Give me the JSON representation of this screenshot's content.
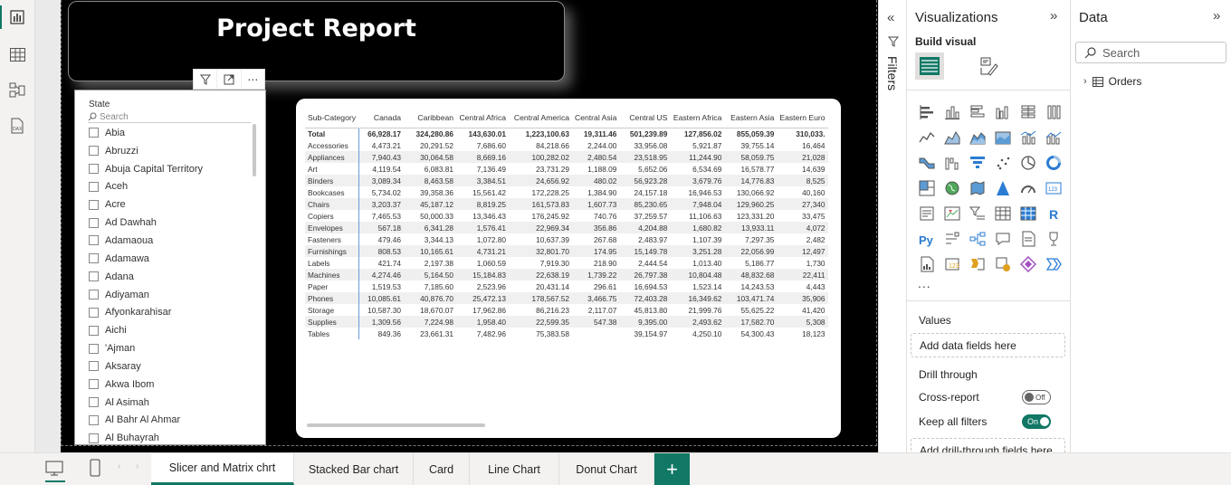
{
  "report_title": "Project Report",
  "slicer": {
    "title": "State",
    "search_placeholder": "Search",
    "items": [
      "Abia",
      "Abruzzi",
      "Abuja Capital Territory",
      "Aceh",
      "Acre",
      "Ad Dawhah",
      "Adamaoua",
      "Adamawa",
      "Adana",
      "Adiyaman",
      "Afyonkarahisar",
      "Aichi",
      "'Ajman",
      "Aksaray",
      "Akwa Ibom",
      "Al Asimah",
      "Al Bahr Al Ahmar",
      "Al Buhayrah"
    ]
  },
  "matrix": {
    "columns": [
      "Sub-Category",
      "Canada",
      "Caribbean",
      "Central Africa",
      "Central America",
      "Central Asia",
      "Central US",
      "Eastern Africa",
      "Eastern Asia",
      "Eastern Euro"
    ],
    "rows": [
      [
        "Total",
        "66,928.17",
        "324,280.86",
        "143,630.01",
        "1,223,100.63",
        "19,311.46",
        "501,239.89",
        "127,856.02",
        "855,059.39",
        "310,033."
      ],
      [
        "Accessories",
        "4,473.21",
        "20,291.52",
        "7,686.60",
        "84,218.66",
        "2,244.00",
        "33,956.08",
        "5,921.87",
        "39,755.14",
        "16,464"
      ],
      [
        "Appliances",
        "7,940.43",
        "30,064.58",
        "8,669.16",
        "100,282.02",
        "2,480.54",
        "23,518.95",
        "11,244.90",
        "58,059.75",
        "21,028"
      ],
      [
        "Art",
        "4,119.54",
        "6,083.81",
        "7,136.49",
        "23,731.29",
        "1,188.09",
        "5,652.06",
        "6,534.69",
        "16,578.77",
        "14,639"
      ],
      [
        "Binders",
        "3,089.34",
        "8,463.58",
        "3,384.51",
        "24,656.92",
        "480.02",
        "56,923.28",
        "3,679.76",
        "14,776.83",
        "8,525"
      ],
      [
        "Bookcases",
        "5,734.02",
        "39,358.36",
        "15,561.42",
        "172,228.25",
        "1,384.90",
        "24,157.18",
        "16,946.53",
        "130,066.92",
        "40,160"
      ],
      [
        "Chairs",
        "3,203.37",
        "45,187.12",
        "8,819.25",
        "161,573.83",
        "1,607.73",
        "85,230.65",
        "7,948.04",
        "129,960.25",
        "27,340"
      ],
      [
        "Copiers",
        "7,465.53",
        "50,000.33",
        "13,346.43",
        "176,245.92",
        "740.76",
        "37,259.57",
        "11,106.63",
        "123,331.20",
        "33,475"
      ],
      [
        "Envelopes",
        "567.18",
        "6,341.28",
        "1,576.41",
        "22,969.34",
        "356.86",
        "4,204.88",
        "1,680.82",
        "13,933.11",
        "4,072"
      ],
      [
        "Fasteners",
        "479.46",
        "3,344.13",
        "1,072.80",
        "10,637.39",
        "267.68",
        "2,483.97",
        "1,107.39",
        "7,297.35",
        "2,482"
      ],
      [
        "Furnishings",
        "808.53",
        "10,165.61",
        "4,731.21",
        "32,801.70",
        "174.95",
        "15,149.78",
        "3,251.28",
        "22,056.99",
        "12,497"
      ],
      [
        "Labels",
        "421.74",
        "2,197.38",
        "1,060.59",
        "7,919.30",
        "218.90",
        "2,444.54",
        "1,013.40",
        "5,186.77",
        "1,730"
      ],
      [
        "Machines",
        "4,274.46",
        "5,164.50",
        "15,184.83",
        "22,638.19",
        "1,739.22",
        "26,797.38",
        "10,804.48",
        "48,832.68",
        "22,411"
      ],
      [
        "Paper",
        "1,519.53",
        "7,185.60",
        "2,523.96",
        "20,431.14",
        "296.61",
        "16,694.53",
        "1,523.14",
        "14,243.53",
        "4,443"
      ],
      [
        "Phones",
        "10,085.61",
        "40,876.70",
        "25,472.13",
        "178,567.52",
        "3,466.75",
        "72,403.28",
        "16,349.62",
        "103,471.74",
        "35,906"
      ],
      [
        "Storage",
        "10,587.30",
        "18,670.07",
        "17,962.86",
        "86,216.23",
        "2,117.07",
        "45,813.80",
        "21,999.76",
        "55,625.22",
        "41,420"
      ],
      [
        "Supplies",
        "1,309.56",
        "7,224.98",
        "1,958.40",
        "22,599.35",
        "547.38",
        "9,395.00",
        "2,493.62",
        "17,582.70",
        "5,308"
      ],
      [
        "Tables",
        "849.36",
        "23,661.31",
        "7,482.96",
        "75,383.58",
        "",
        "39,154.97",
        "4,250.10",
        "54,300.43",
        "18,123"
      ]
    ]
  },
  "filters_label": "Filters",
  "visualizations": {
    "title": "Visualizations",
    "build_visual": "Build visual",
    "more": "...",
    "values_label": "Values",
    "values_drop": "Add data fields here",
    "drill_through": "Drill through",
    "cross_report": "Cross-report",
    "cross_report_state": "Off",
    "keep_all_filters": "Keep all filters",
    "keep_all_filters_state": "On",
    "drill_drop": "Add drill-through fields here"
  },
  "data_pane": {
    "title": "Data",
    "search_placeholder": "Search",
    "tables": [
      "Orders"
    ]
  },
  "tabs": [
    "Slicer and Matrix chrt",
    "Stacked Bar chart",
    "Card",
    "Line Chart",
    "Donut Chart"
  ],
  "active_tab": "Slicer and Matrix chrt",
  "add_tab": "+"
}
